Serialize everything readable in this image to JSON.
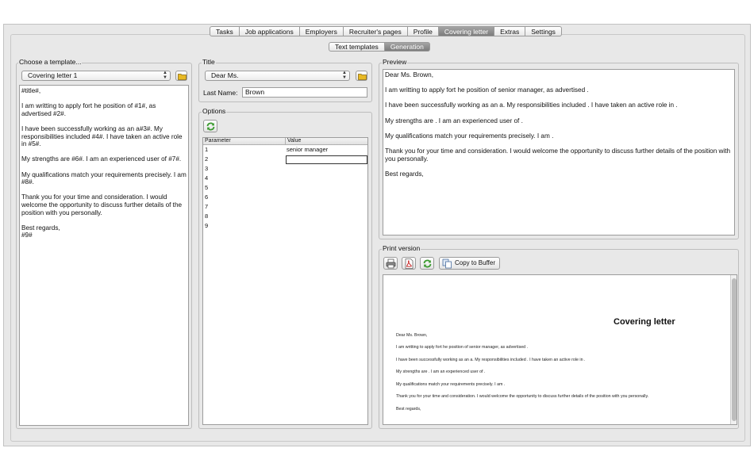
{
  "tabs": [
    {
      "label": "Tasks",
      "active": false
    },
    {
      "label": "Job applications",
      "active": false
    },
    {
      "label": "Employers",
      "active": false
    },
    {
      "label": "Recruiter's pages",
      "active": false
    },
    {
      "label": "Profile",
      "active": false
    },
    {
      "label": "Covering letter",
      "active": true
    },
    {
      "label": "Extras",
      "active": false
    },
    {
      "label": "Settings",
      "active": false
    }
  ],
  "subtabs": [
    {
      "label": "Text templates",
      "active": false
    },
    {
      "label": "Generation",
      "active": true
    }
  ],
  "template_panel": {
    "label": "Choose a template...",
    "selected": "Covering letter 1",
    "paragraphs": [
      "#title#,",
      "I am writting to apply fort he position of #1#, as advertised #2#.",
      "I have been successfully working as an a#3#. My responsibilities included #4#. I have taken an active role in #5#.",
      "My strengths are #6#. I am an experienced user of #7#.",
      "My qualifications match your requirements precisely. I am #8#.",
      "Thank you for your time and consideration. I would welcome the opportunity to discuss further details of the position with you personally.",
      "Best regards,\n#9#"
    ]
  },
  "title_panel": {
    "label": "Title",
    "selected": "Dear Ms.",
    "last_name_label": "Last Name:",
    "last_name_value": "Brown"
  },
  "options_panel": {
    "label": "Options",
    "columns": [
      "Parameter",
      "Value"
    ],
    "rows": [
      {
        "param": "1",
        "value": "senior manager"
      },
      {
        "param": "2",
        "value": ""
      },
      {
        "param": "3",
        "value": ""
      },
      {
        "param": "4",
        "value": ""
      },
      {
        "param": "5",
        "value": ""
      },
      {
        "param": "6",
        "value": ""
      },
      {
        "param": "7",
        "value": ""
      },
      {
        "param": "8",
        "value": ""
      },
      {
        "param": "9",
        "value": ""
      }
    ]
  },
  "preview_panel": {
    "label": "Preview",
    "paragraphs": [
      "Dear Ms. Brown,",
      "I am writting to apply fort he position of senior manager, as advertised .",
      "I have been successfully working as an a. My responsibilities included . I have taken an active role in .",
      "My strengths are . I am an experienced user of .",
      "My qualifications match your requirements precisely. I am .",
      "Thank you for your time and consideration. I would welcome the opportunity to discuss further details of the position with you personally.",
      "Best regards,"
    ]
  },
  "print_panel": {
    "label": "Print version",
    "copy_label": "Copy to Buffer",
    "doc_title": "Covering letter",
    "lines": [
      "Dear Ms. Brown,",
      "I am writting to apply fort he position of senior manager, as advertised .",
      "I have been successfully working as an a. My responsibilities included . I have taken an active role in .",
      "My strengths are . I am an experienced user of .",
      "My qualifications match your requirements precisely. I am .",
      "Thank you for your time and consideration. I would welcome the opportunity to discuss further details of the position with you personally.",
      "Best regards,"
    ]
  },
  "icons": {
    "folder": "folder-icon",
    "refresh": "refresh-icon",
    "print": "printer-icon",
    "pdf": "pdf-icon",
    "copy": "copy-icon"
  },
  "colors": {
    "active_tab": "#8a8a8a",
    "refresh_green": "#3a9a2e",
    "pdf_red": "#c62828",
    "folder_yellow": "#e8b923"
  }
}
